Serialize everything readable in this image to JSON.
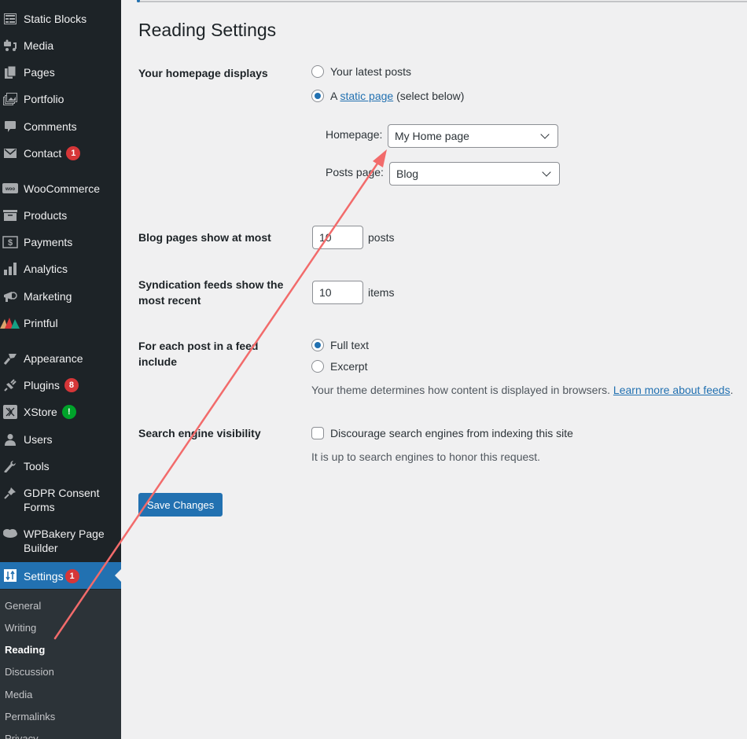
{
  "sidebar": {
    "items": [
      {
        "label": "Static Blocks",
        "icon": "static-blocks-icon"
      },
      {
        "label": "Media",
        "icon": "media-icon"
      },
      {
        "label": "Pages",
        "icon": "pages-icon"
      },
      {
        "label": "Portfolio",
        "icon": "portfolio-icon"
      },
      {
        "label": "Comments",
        "icon": "comments-icon"
      },
      {
        "label": "Contact",
        "icon": "mail-icon",
        "badge": "1"
      },
      {
        "label": "WooCommerce",
        "icon": "woo-icon"
      },
      {
        "label": "Products",
        "icon": "products-icon"
      },
      {
        "label": "Payments",
        "icon": "payments-icon"
      },
      {
        "label": "Analytics",
        "icon": "analytics-icon"
      },
      {
        "label": "Marketing",
        "icon": "megaphone-icon"
      },
      {
        "label": "Printful",
        "icon": "printful-icon"
      },
      {
        "label": "Appearance",
        "icon": "brush-icon"
      },
      {
        "label": "Plugins",
        "icon": "plug-icon",
        "badge": "8"
      },
      {
        "label": "XStore",
        "icon": "xstore-icon",
        "badge": "!"
      },
      {
        "label": "Users",
        "icon": "user-icon"
      },
      {
        "label": "Tools",
        "icon": "wrench-icon"
      },
      {
        "label": "GDPR Consent Forms",
        "icon": "pin-icon"
      },
      {
        "label": "WPBakery Page Builder",
        "icon": "cloud-icon"
      },
      {
        "label": "Settings",
        "icon": "settings-icon",
        "badge": "1"
      }
    ],
    "submenu": [
      "General",
      "Writing",
      "Reading",
      "Discussion",
      "Media",
      "Permalinks",
      "Privacy"
    ],
    "current_submenu": "Reading"
  },
  "page": {
    "title": "Reading Settings",
    "homepage_displays": {
      "label": "Your homepage displays",
      "option_latest": "Your latest posts",
      "option_static_prefix": "A",
      "option_static_link": "static page",
      "option_static_suffix": "(select below)",
      "selected": "static",
      "homepage_label": "Homepage:",
      "homepage_value": "My Home page",
      "posts_page_label": "Posts page:",
      "posts_page_value": "Blog"
    },
    "blog_pages": {
      "label": "Blog pages show at most",
      "value": "10",
      "unit": "posts"
    },
    "syndication": {
      "label": "Syndication feeds show the most recent",
      "value": "10",
      "unit": "items"
    },
    "feed_include": {
      "label": "For each post in a feed include",
      "option_full": "Full text",
      "option_excerpt": "Excerpt",
      "selected": "full",
      "description": "Your theme determines how content is displayed in browsers.",
      "link": "Learn more about feeds",
      "link_suffix": "."
    },
    "search_visibility": {
      "label": "Search engine visibility",
      "checkbox_label": "Discourage search engines from indexing this site",
      "checked": false,
      "description": "It is up to search engines to honor this request."
    },
    "save_label": "Save Changes"
  },
  "colors": {
    "sidebar_bg": "#1d2327",
    "accent": "#2271b1",
    "badge_red": "#d63638",
    "badge_green": "#00a32a",
    "annotation_arrow": "#f26b6b"
  }
}
